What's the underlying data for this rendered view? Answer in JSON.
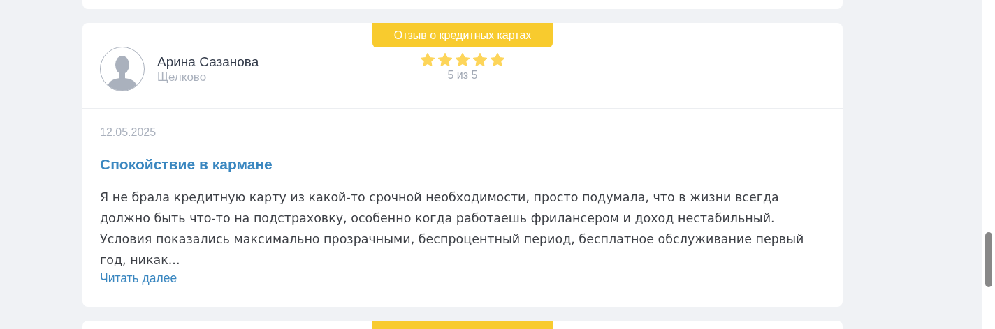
{
  "reviews": [
    {
      "category": "Отзыв о кредитных картах",
      "author": {
        "name": "Арина Сазанова",
        "city": "Щелково"
      },
      "stars": 5,
      "rating_text": "5 из 5",
      "date": "12.05.2025",
      "title": "Спокойствие в кармане",
      "text": "Я не брала кредитную карту из какой-то срочной необходимости, просто подумала, что в жизни всегда должно быть что-то на подстраховку, особенно когда работаешь фрилансером и доход нестабильный. Условия показались максимально прозрачными, беспроцентный период, бесплатное обслуживание первый год, никак...",
      "read_more": "Читать далее"
    }
  ]
}
